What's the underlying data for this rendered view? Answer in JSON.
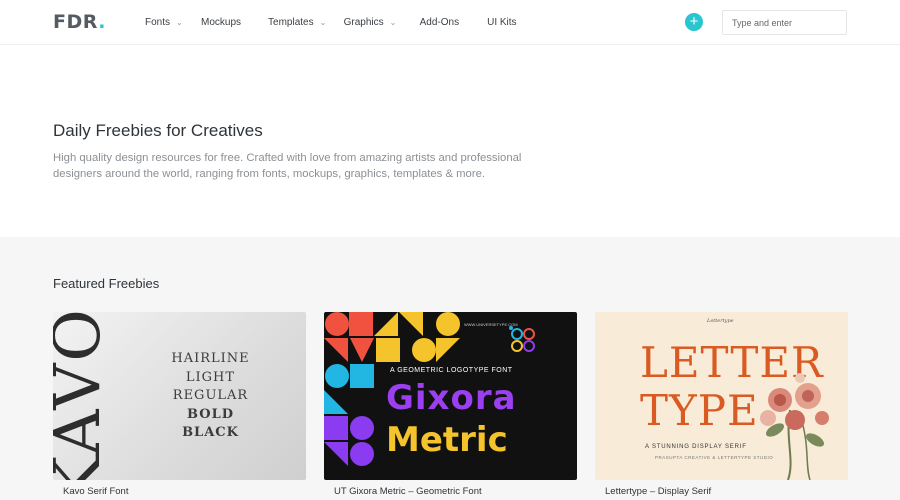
{
  "header": {
    "logo": {
      "text": "FDR",
      "dot": "."
    },
    "nav": [
      {
        "label": "Fonts",
        "has_dropdown": true
      },
      {
        "label": "Mockups",
        "has_dropdown": false
      },
      {
        "label": "Templates",
        "has_dropdown": true
      },
      {
        "label": "Graphics",
        "has_dropdown": true
      },
      {
        "label": "Add-Ons",
        "has_dropdown": false
      },
      {
        "label": "UI Kits",
        "has_dropdown": false
      }
    ],
    "add_button": {
      "icon": "plus-icon",
      "glyph": "+",
      "color": "#29c6cf"
    },
    "search": {
      "placeholder": "Type and enter",
      "value": ""
    }
  },
  "hero": {
    "title": "Daily Freebies for Creatives",
    "description": "High quality design resources for free. Crafted with love from amazing artists and professional designers around the world, ranging from fonts, mockups, graphics, templates & more."
  },
  "featured": {
    "title": "Featured Freebies",
    "cards": [
      {
        "title": "Kavo Serif Font",
        "preview": {
          "big_word": "KAVO",
          "weights": [
            "HAIRLINE",
            "LIGHT",
            "REGULAR",
            "BOLD",
            "BLACK"
          ]
        }
      },
      {
        "title": "UT Gixora Metric – Geometric Font",
        "preview": {
          "tagline": "A GEOMETRIC LOGOTYPE FONT",
          "word1": "Gixora",
          "word2": "Metric",
          "site": "WWW.UNIVERSETYPE.COM"
        }
      },
      {
        "title": "Lettertype – Display Serif",
        "preview": {
          "script": "Lettertype",
          "line1": "LETTER",
          "line2": "TYPE",
          "subtitle": "A STUNNING DISPLAY SERIF",
          "studio": "PRASUPTA CREATIVE & LETTERTYPE STUDIO"
        }
      }
    ]
  },
  "colors": {
    "accent": "#29c6cf",
    "featured_bg": "#f6f6f6",
    "letter_orange": "#d95a22"
  }
}
